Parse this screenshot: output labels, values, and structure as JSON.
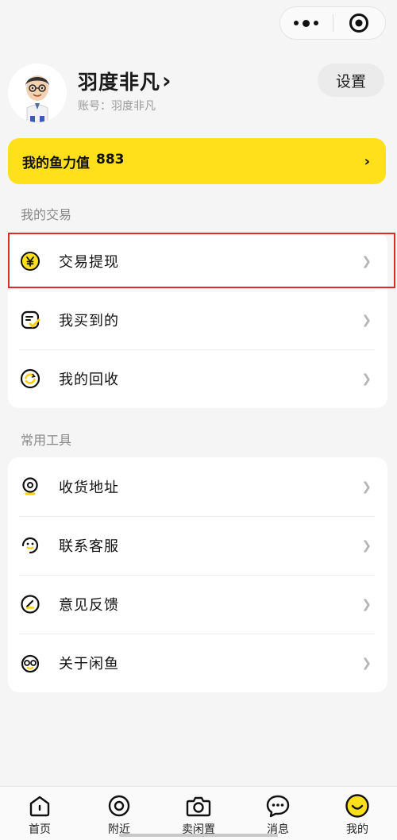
{
  "capsule": {
    "more_icon": "more-dots-icon",
    "close_icon": "target-close-icon"
  },
  "profile": {
    "nickname": "羽度非凡",
    "nickname_arrow": "›",
    "account": "账号：羽度非凡",
    "settings_label": "设置",
    "avatar_icon": "cartoon-avatar"
  },
  "power": {
    "label": "我的鱼力值",
    "value": "883",
    "arrow": "›"
  },
  "trade_section": {
    "title": "我的交易",
    "items": [
      {
        "label": "交易提现",
        "icon": "yuan-coin-icon"
      },
      {
        "label": "我买到的",
        "icon": "bought-bag-icon"
      },
      {
        "label": "我的回收",
        "icon": "recycle-icon"
      }
    ]
  },
  "tools_section": {
    "title": "常用工具",
    "items": [
      {
        "label": "收货地址",
        "icon": "location-pin-icon"
      },
      {
        "label": "联系客服",
        "icon": "customer-service-icon"
      },
      {
        "label": "意见反馈",
        "icon": "feedback-icon"
      },
      {
        "label": "关于闲鱼",
        "icon": "xianyu-logo-icon"
      }
    ]
  },
  "tabbar": {
    "items": [
      {
        "label": "首页",
        "icon": "home-icon"
      },
      {
        "label": "附近",
        "icon": "nearby-icon"
      },
      {
        "label": "卖闲置",
        "icon": "camera-icon"
      },
      {
        "label": "消息",
        "icon": "message-icon"
      },
      {
        "label": "我的",
        "icon": "smile-face-icon",
        "active": true
      }
    ]
  },
  "colors": {
    "brand_yellow": "#ffe01b",
    "highlight_red": "#e02929",
    "background": "#f5f5f5"
  }
}
